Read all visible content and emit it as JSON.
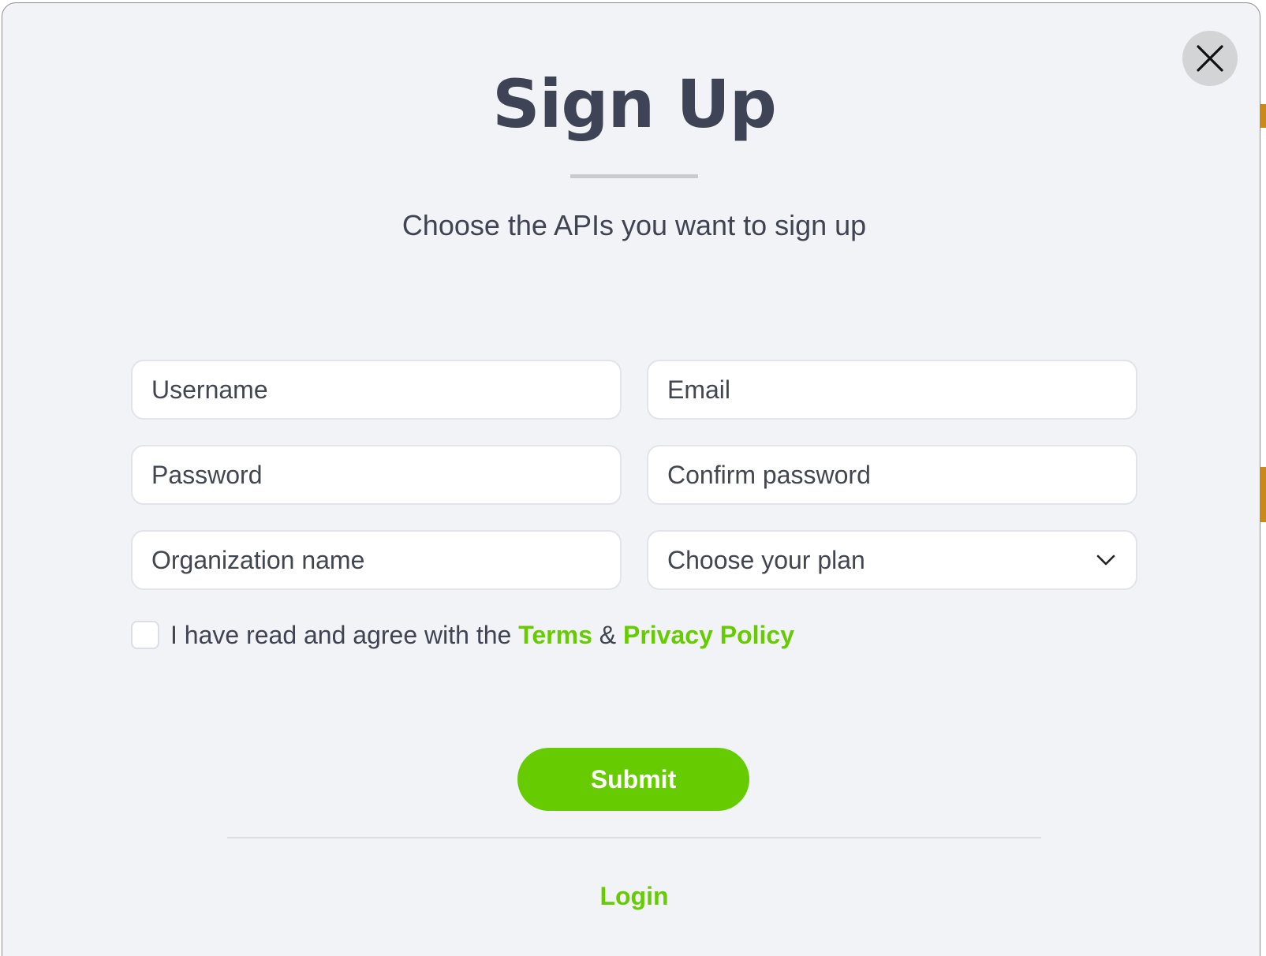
{
  "modal": {
    "title": "Sign Up",
    "subtitle": "Choose the APIs you want to sign up",
    "close_icon": "close-icon"
  },
  "form": {
    "username_placeholder": "Username",
    "email_placeholder": "Email",
    "password_placeholder": "Password",
    "confirm_password_placeholder": "Confirm password",
    "organization_placeholder": "Organization name",
    "plan_select": {
      "selected": "Choose your plan",
      "icon": "chevron-down-icon"
    },
    "agree": {
      "checked": false,
      "prefix": "I have read and agree with the",
      "terms": "Terms",
      "separator": "&",
      "privacy": "Privacy Policy"
    },
    "submit_label": "Submit"
  },
  "footer": {
    "login_label": "Login"
  },
  "colors": {
    "accent": "#66cb00",
    "heading": "#3e4456",
    "modal_bg": "#f2f3f6",
    "input_border": "#e2e4ea"
  }
}
